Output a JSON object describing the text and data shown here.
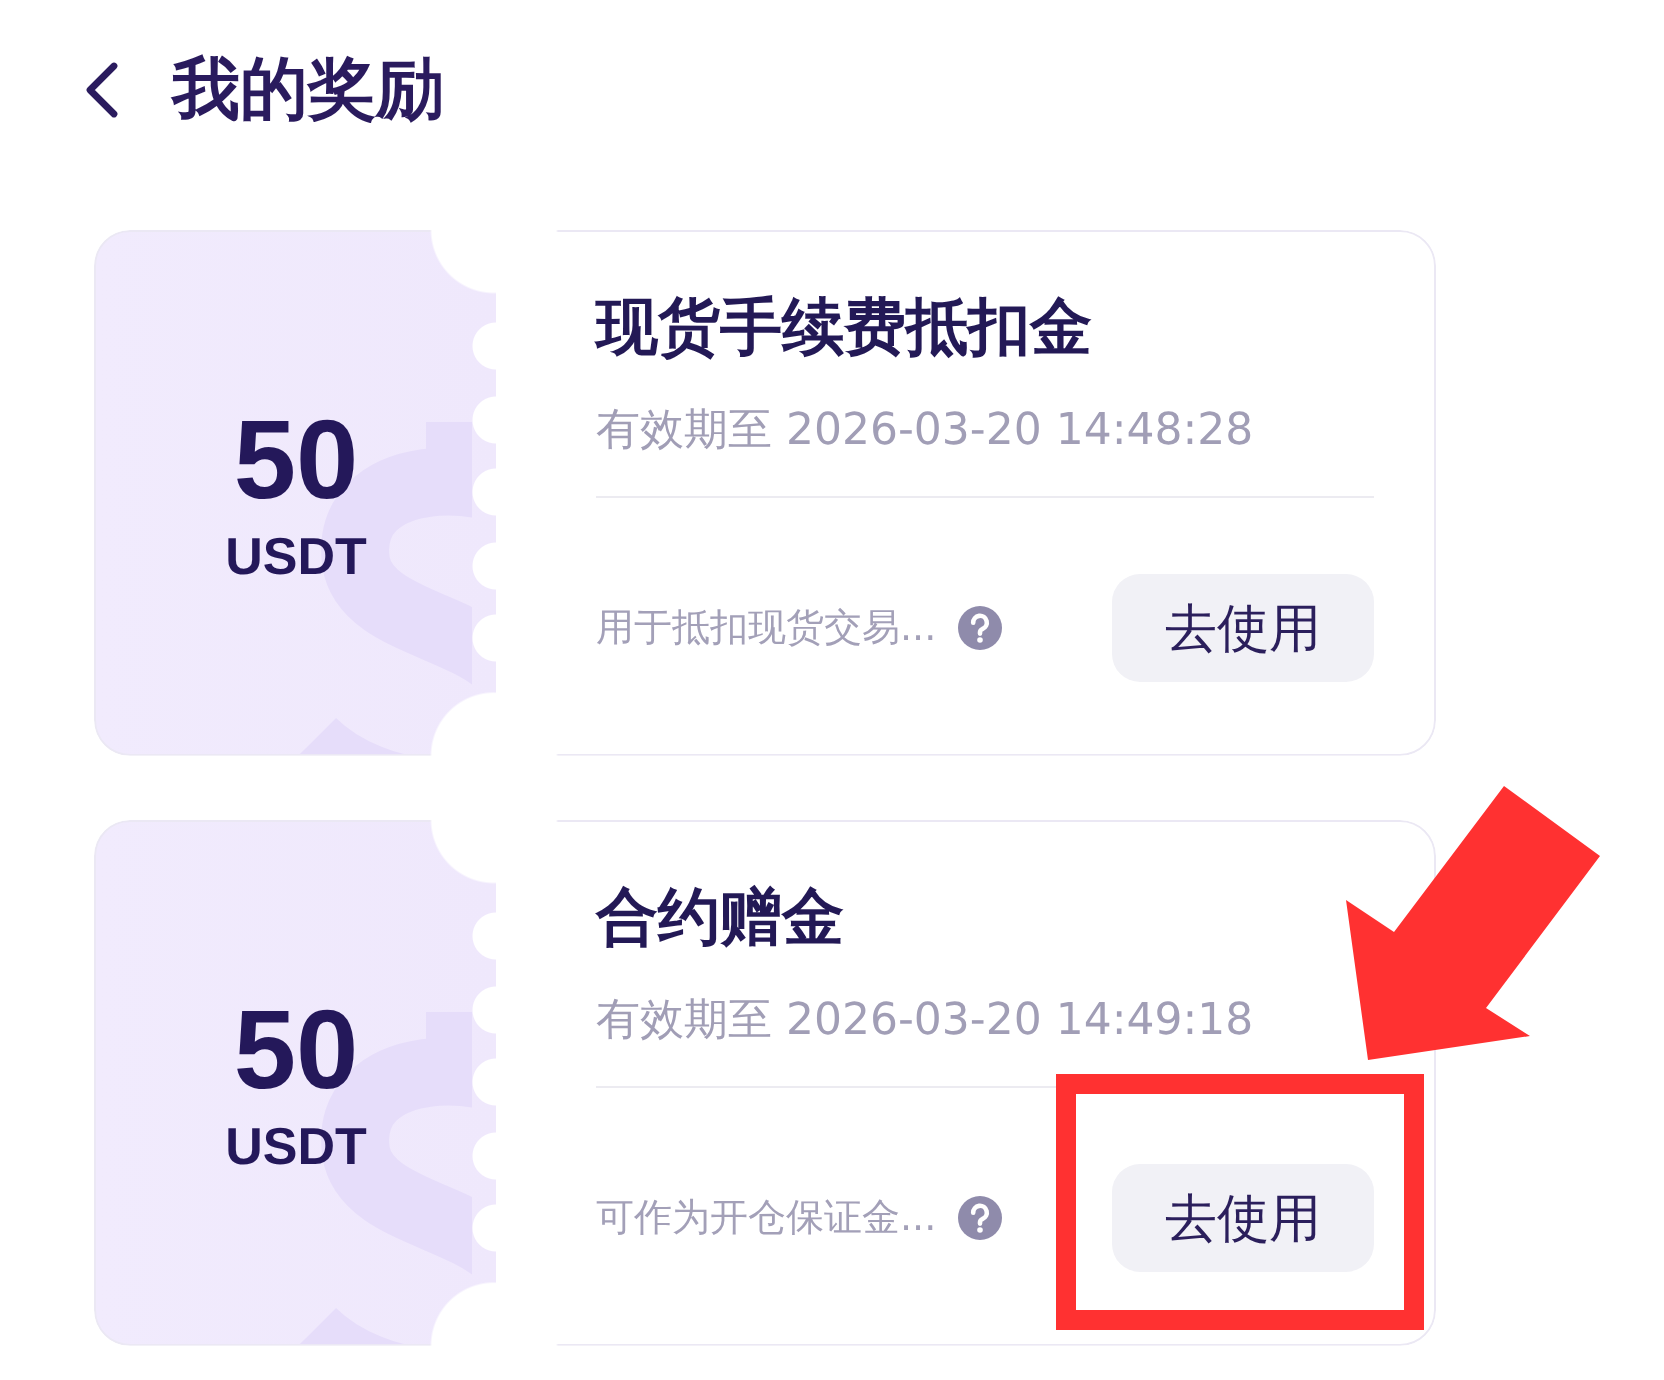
{
  "header": {
    "title": "我的奖励"
  },
  "cards": [
    {
      "amount": "50",
      "unit": "USDT",
      "title": "现货手续费抵扣金",
      "expiry": "有效期至 2026-03-20 14:48:28",
      "description": "用于抵扣现货交易...",
      "button": "去使用",
      "highlighted": false
    },
    {
      "amount": "50",
      "unit": "USDT",
      "title": "合约赠金",
      "expiry": "有效期至 2026-03-20 14:49:18",
      "description": "可作为开仓保证金...",
      "button": "去使用",
      "highlighted": true
    }
  ]
}
